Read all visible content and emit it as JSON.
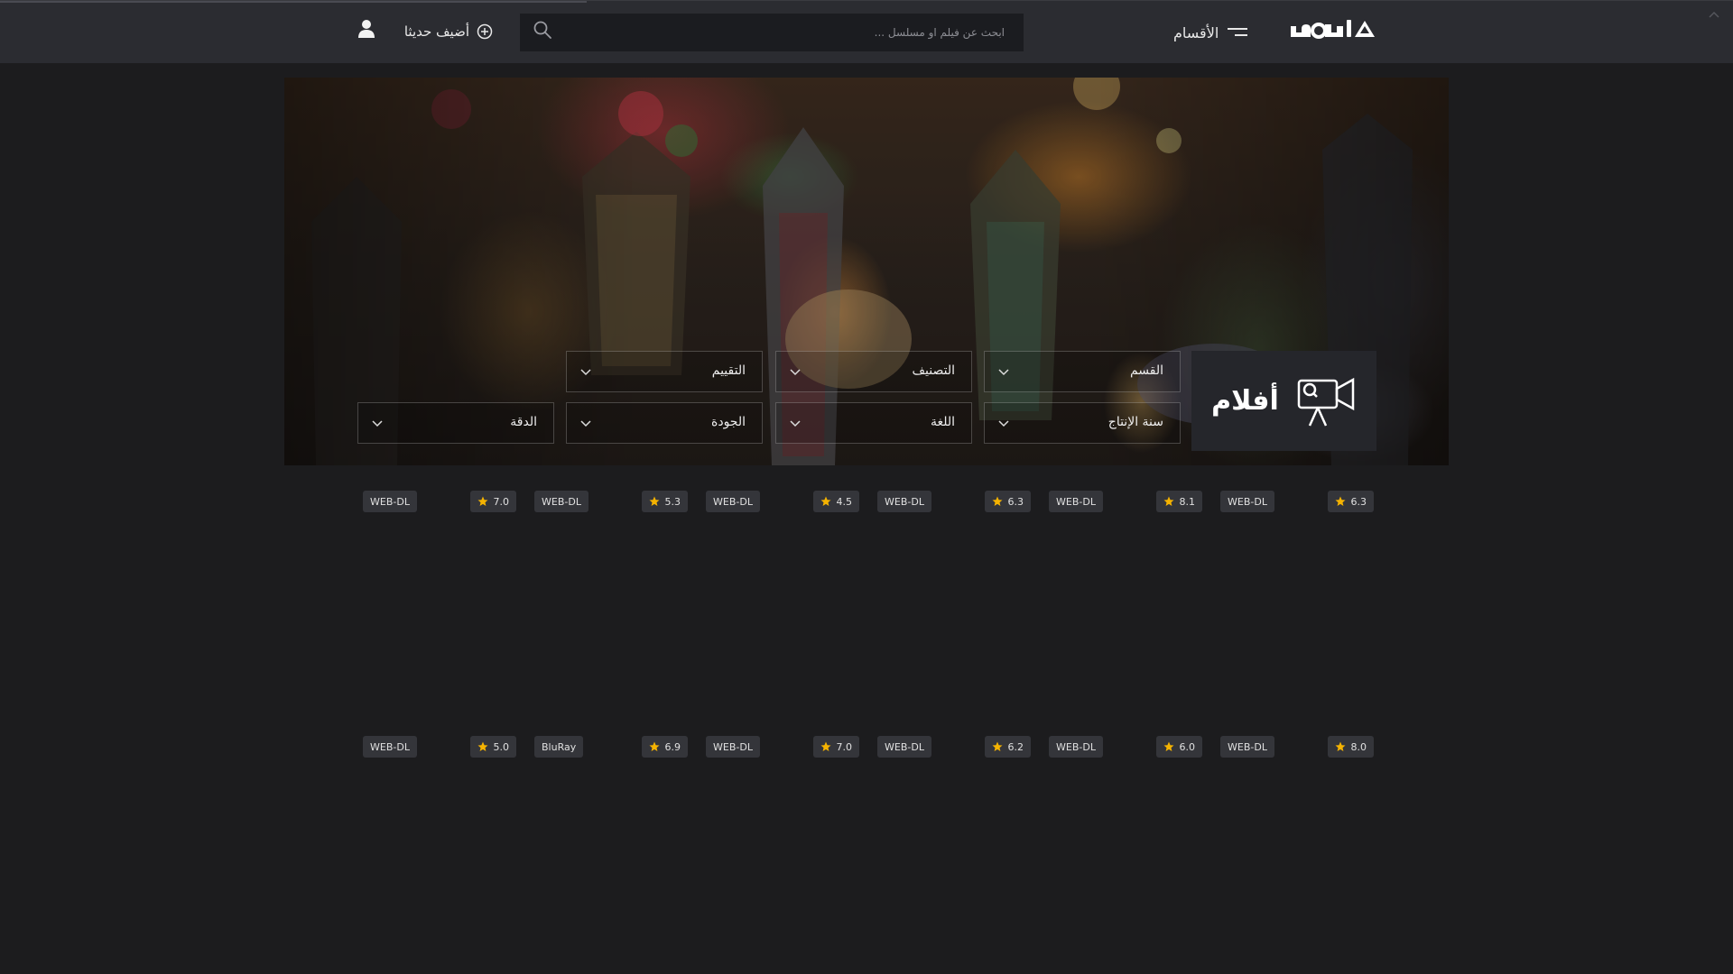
{
  "header": {
    "logo_text": "اكوام",
    "menu_label": "الأقسام",
    "search_placeholder": "ابحث عن فيلم او مسلسل ...",
    "add_recent_label": "أضيف حديثا"
  },
  "hero": {
    "section_title": "أفلام",
    "filters": [
      {
        "label": "القسم"
      },
      {
        "label": "التصنيف"
      },
      {
        "label": "التقييم"
      },
      {
        "label": "سنة الإنتاج"
      },
      {
        "label": "اللغة"
      },
      {
        "label": "الجودة"
      },
      {
        "label": "الدقة"
      }
    ]
  },
  "movies": [
    {
      "rating": "6.3",
      "quality": "WEB-DL"
    },
    {
      "rating": "8.1",
      "quality": "WEB-DL"
    },
    {
      "rating": "6.3",
      "quality": "WEB-DL"
    },
    {
      "rating": "4.5",
      "quality": "WEB-DL"
    },
    {
      "rating": "5.3",
      "quality": "WEB-DL"
    },
    {
      "rating": "7.0",
      "quality": "WEB-DL"
    },
    {
      "rating": "8.0",
      "quality": "WEB-DL"
    },
    {
      "rating": "6.0",
      "quality": "WEB-DL"
    },
    {
      "rating": "6.2",
      "quality": "WEB-DL"
    },
    {
      "rating": "7.0",
      "quality": "WEB-DL"
    },
    {
      "rating": "6.9",
      "quality": "BluRay"
    },
    {
      "rating": "5.0",
      "quality": "WEB-DL"
    }
  ],
  "colors": {
    "background": "#1c1c1e",
    "header": "#2b2c31",
    "badge": "#34353a",
    "star": "#f5b301"
  }
}
